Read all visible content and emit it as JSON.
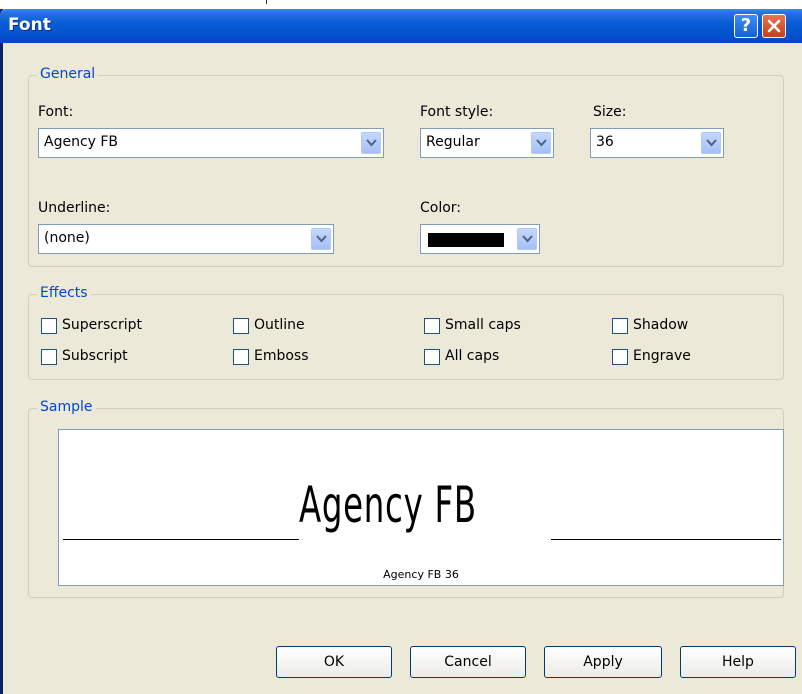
{
  "window": {
    "title": "Font",
    "help_glyph": "?"
  },
  "general": {
    "legend": "General",
    "font_label": "Font:",
    "font_value": "Agency FB",
    "style_label": "Font style:",
    "style_value": "Regular",
    "size_label": "Size:",
    "size_value": "36",
    "underline_label": "Underline:",
    "underline_value": "(none)",
    "color_label": "Color:",
    "color_value": "#000000"
  },
  "effects": {
    "legend": "Effects",
    "items": [
      {
        "label": "Superscript",
        "checked": false
      },
      {
        "label": "Outline",
        "checked": false
      },
      {
        "label": "Small caps",
        "checked": false
      },
      {
        "label": "Shadow",
        "checked": false
      },
      {
        "label": "Subscript",
        "checked": false
      },
      {
        "label": "Emboss",
        "checked": false
      },
      {
        "label": "All caps",
        "checked": false
      },
      {
        "label": "Engrave",
        "checked": false
      }
    ]
  },
  "sample": {
    "legend": "Sample",
    "text": "Agency FB",
    "caption": "Agency FB 36"
  },
  "buttons": {
    "ok": "OK",
    "cancel": "Cancel",
    "apply": "Apply",
    "help": "Help"
  },
  "colors": {
    "titlebar": "#0454CF",
    "dialog_bg": "#ECE9D8",
    "legend_text": "#0046D5"
  }
}
